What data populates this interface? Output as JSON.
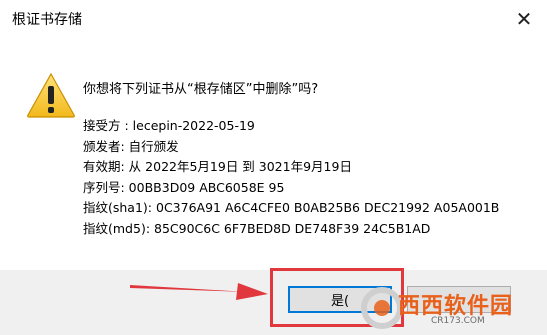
{
  "window": {
    "title": "根证书存储",
    "close_glyph": "✕"
  },
  "dialog": {
    "icon": "warning-icon",
    "question": "你想将下列证书从“根存储区”中删除”吗?",
    "details": [
      "接受方 : lecepin-2022-05-19",
      "颁发者: 自行颁发",
      "有效期: 从 2022年5月19日 到 3021年9月19日",
      "序列号: 00BB3D09 ABC6058E 95",
      "指纹(sha1): 0C376A91 A6C4CFE0 B0AB25B6 DEC21992 A05A001B",
      "指纹(md5): 85C90C6C 6F7BED8D DE748F39 24C5B1AD"
    ]
  },
  "buttons": {
    "yes_label": "是(",
    "no_label": ""
  },
  "annotation": {
    "highlight_color": "#e0383d"
  },
  "watermark": {
    "brand": "西西软件园",
    "url": "CR173.COM"
  }
}
